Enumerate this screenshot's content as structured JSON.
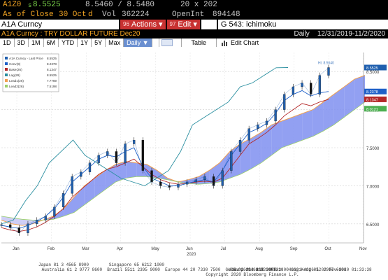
{
  "quote": {
    "ticker": "A1Z0",
    "last_prefix": "s",
    "last": "8.5525",
    "bid_ask": "8.5460 / 8.5480",
    "size": "20 x 202",
    "as_of_label": "As of Close",
    "date": "30 Oct",
    "date_suffix": "d",
    "vol_label": "Vol",
    "vol": "362224",
    "oi_label": "OpenInt",
    "oi": "894148"
  },
  "command_bar": {
    "security": "A1A Curncy",
    "actions_num": "96",
    "actions_label": "Actions",
    "edit_num": "97",
    "edit_label": "Edit",
    "function_label": "G 543: ichimoku"
  },
  "title": {
    "name": "A1A Curncy : TRY DOLLAR FUTURE Dec20",
    "period": "Daily",
    "range": "12/31/2019-11/2/2020"
  },
  "toolbar": {
    "ranges": [
      "1D",
      "3D",
      "1M",
      "6M",
      "YTD",
      "1Y",
      "5Y",
      "Max"
    ],
    "frequency": "Daily ▼",
    "table_label": "Table",
    "edit_chart_label": "Edit Chart"
  },
  "legend": [
    {
      "label": "A1A Curncy - Last Price",
      "value": "8.5525",
      "color": "#1f5fae"
    },
    {
      "label": "Conv(9)",
      "value": "8.2378",
      "color": "#1e60c8"
    },
    {
      "label": "Base(26)",
      "value": "8.1347",
      "color": "#b42828"
    },
    {
      "label": "Lag(26)",
      "value": "8.5525",
      "color": "#2a8fa0"
    },
    {
      "label": "Lead1(26)",
      "value": "7.7769",
      "color": "#f0a050"
    },
    {
      "label": "Lead2(26)",
      "value": "7.5198",
      "color": "#9ad06a"
    }
  ],
  "price_tags": [
    {
      "value": "8.5525",
      "color": "#1f5fae"
    },
    {
      "value": "8.2378",
      "color": "#1e60c8"
    },
    {
      "value": "8.1347",
      "color": "#b42828"
    },
    {
      "value": "8.0121",
      "color": "#4caf50"
    }
  ],
  "annotations": {
    "high": "Hi: 8.5640"
  },
  "chart_data": {
    "type": "line",
    "x_labels": [
      "Jan",
      "Feb",
      "Mar",
      "Apr",
      "May",
      "Jun",
      "Jul",
      "Aug",
      "Sep",
      "Oct",
      "Nov"
    ],
    "year_label": "2020",
    "y_ticks": [
      "8.5000",
      "8.0000",
      "7.5000",
      "7.0000",
      "6.5000"
    ],
    "ylim": [
      6.25,
      8.75
    ],
    "series": [
      {
        "name": "A1A Curncy - Last Price",
        "values": [
          6.49,
          6.45,
          6.38,
          6.5,
          6.55,
          6.6,
          6.72,
          6.9,
          7.12,
          7.18,
          7.3,
          7.4,
          7.45,
          7.3,
          7.55,
          7.6,
          7.2,
          7.05,
          7.0,
          6.98,
          7.02,
          7.05,
          7.08,
          7.12,
          7.0,
          7.2,
          7.45,
          7.6,
          7.75,
          7.8,
          7.85,
          8.0,
          8.2,
          8.3,
          8.35,
          8.2,
          8.45,
          8.5525
        ]
      },
      {
        "name": "Conv(9)",
        "values": [
          6.48,
          6.46,
          6.44,
          6.48,
          6.53,
          6.6,
          6.7,
          6.85,
          7.05,
          7.15,
          7.25,
          7.35,
          7.4,
          7.38,
          7.45,
          7.5,
          7.25,
          7.1,
          7.05,
          7.0,
          7.0,
          7.03,
          7.06,
          7.08,
          7.05,
          7.2,
          7.4,
          7.55,
          7.7,
          7.75,
          7.82,
          7.95,
          8.12,
          8.2,
          8.25,
          8.18,
          8.22,
          8.2378
        ]
      },
      {
        "name": "Base(26)",
        "values": [
          6.45,
          6.42,
          6.4,
          6.42,
          6.46,
          6.52,
          6.6,
          6.7,
          6.85,
          6.95,
          7.05,
          7.15,
          7.22,
          7.25,
          7.3,
          7.35,
          7.25,
          7.15,
          7.08,
          7.04,
          7.02,
          7.03,
          7.05,
          7.06,
          7.05,
          7.1,
          7.25,
          7.4,
          7.55,
          7.62,
          7.7,
          7.8,
          7.92,
          8.0,
          8.08,
          8.05,
          8.1,
          8.1347
        ]
      },
      {
        "name": "Lag(26)",
        "values": [
          6.5,
          6.55,
          6.8,
          7.0,
          7.3,
          7.45,
          7.6,
          7.4,
          7.3,
          7.2,
          7.1,
          7.05,
          7.0,
          7.1,
          7.2,
          7.45,
          7.8,
          7.9,
          8.0,
          8.1,
          8.3,
          8.35,
          8.45,
          8.55,
          8.5525
        ]
      },
      {
        "name": "Lead1(26)",
        "values": [
          6.55,
          6.5,
          6.48,
          6.5,
          6.55,
          6.6,
          6.7,
          6.85,
          7.0,
          7.1,
          7.2,
          7.28,
          7.32,
          7.3,
          7.28,
          7.2,
          7.1,
          7.05,
          7.08,
          7.12,
          7.2,
          7.3,
          7.45,
          7.55,
          7.62,
          7.7,
          7.8,
          7.85,
          7.9,
          7.95,
          8.0,
          8.1,
          8.2,
          8.3,
          8.4,
          8.45
        ]
      },
      {
        "name": "Lead2(26)",
        "values": [
          6.6,
          6.58,
          6.56,
          6.55,
          6.55,
          6.56,
          6.6,
          6.65,
          6.75,
          6.85,
          6.95,
          7.05,
          7.1,
          7.12,
          7.12,
          7.1,
          7.08,
          7.05,
          7.03,
          7.02,
          7.03,
          7.05,
          7.1,
          7.15,
          7.22,
          7.3,
          7.4,
          7.5,
          7.55,
          7.6,
          7.65,
          7.72,
          7.8,
          7.9,
          8.0,
          8.1
        ]
      }
    ]
  },
  "footer": {
    "line1": "Australia 61 2 9777 8600  Brazil 5511 2395 9000  Europe 44 20 7330 7500  Germany 49 69 9204 1210  Hong Kong 852 2977 6000",
    "line2_left": "Japan 81 3 4565 8900        Singapore 65 6212 1000",
    "line2_mid": "U.S. 1 212 318 2000",
    "line2_right": "Copyright 2020 Bloomberg Finance L.P.",
    "line3_right": "SN 926204 AST  GMT+3:00 G631-4326-1 02-Nov-2020 01:33:38"
  }
}
